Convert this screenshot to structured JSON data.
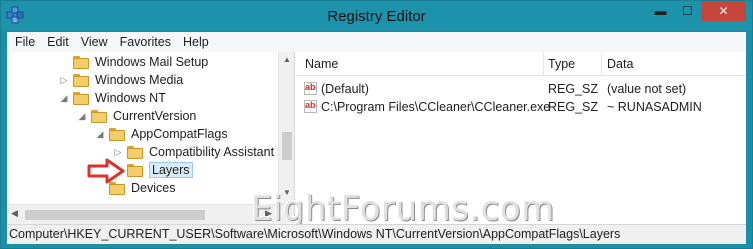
{
  "window": {
    "title": "Registry Editor",
    "minimize": "▬",
    "maximize": "☐",
    "close": "✕"
  },
  "menu": [
    "File",
    "Edit",
    "View",
    "Favorites",
    "Help"
  ],
  "tree": [
    {
      "label": "Windows Mail Setup",
      "expander": ""
    },
    {
      "label": "Windows Media",
      "expander": "▷"
    },
    {
      "label": "Windows NT",
      "expander": "◢"
    },
    {
      "label": "CurrentVersion",
      "expander": "◢"
    },
    {
      "label": "AppCompatFlags",
      "expander": "◢"
    },
    {
      "label": "Compatibility Assistant",
      "expander": "▷"
    },
    {
      "label": "Layers",
      "expander": "",
      "selected": true
    },
    {
      "label": "Devices",
      "expander": ""
    }
  ],
  "list": {
    "columns": [
      "Name",
      "Type",
      "Data"
    ],
    "rows": [
      {
        "name": "(Default)",
        "type": "REG_SZ",
        "data": "(value not set)"
      },
      {
        "name": "C:\\Program Files\\CCleaner\\CCleaner.exe",
        "type": "REG_SZ",
        "data": "~ RUNASADMIN"
      }
    ]
  },
  "status": {
    "path": "Computer\\HKEY_CURRENT_USER\\Software\\Microsoft\\Windows NT\\CurrentVersion\\AppCompatFlags\\Layers"
  },
  "watermark": "EightForums.com",
  "colors": {
    "titlebar": "#1d93ab",
    "close_button": "#c7463c",
    "folder": "#f2cd69",
    "annotation_arrow": "#d9342b"
  },
  "icons": {
    "app": "registry-editor-icon",
    "tree_item": "folder-icon",
    "value": "string-value-icon",
    "annotation": "red-arrow-icon"
  }
}
